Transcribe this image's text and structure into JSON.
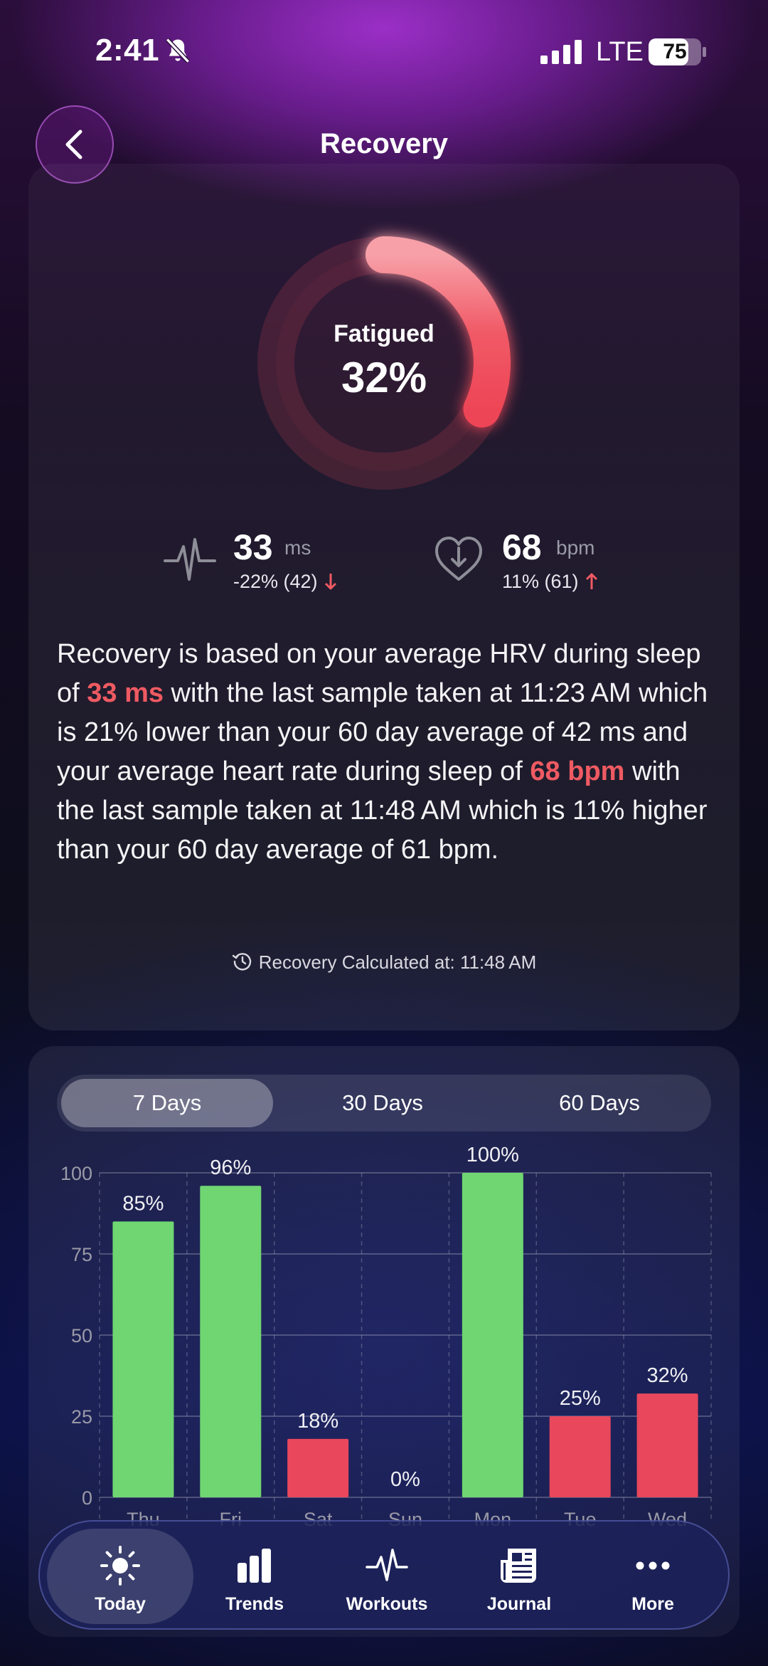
{
  "status_bar": {
    "time": "2:41",
    "network": "LTE",
    "battery": "75",
    "battery_level": 0.75
  },
  "header": {
    "title": "Recovery"
  },
  "recovery": {
    "state": "Fatigued",
    "percent_text": "32%",
    "percent": 32,
    "ring_color": "#f0505c"
  },
  "metrics": {
    "hrv": {
      "value": "33",
      "unit": "ms",
      "delta": "-22% (42)",
      "direction": "down"
    },
    "heart_rate": {
      "value": "68",
      "unit": "bpm",
      "delta": "11% (61)",
      "direction": "up"
    }
  },
  "description": {
    "p1": "Recovery is based on your average HRV during sleep of ",
    "hl1": "33 ms",
    "p2": " with the last sample taken at 11:23 AM which is 21% lower than your 60 day average of 42 ms and your average heart rate during sleep of ",
    "hl2": "68 bpm",
    "p3": " with the last sample taken at 11:48 AM which is 11% higher than your 60 day average of 61 bpm."
  },
  "calculated_at": "Recovery Calculated at: 11:48 AM",
  "range_tabs": [
    {
      "label": "7 Days",
      "active": true
    },
    {
      "label": "30 Days",
      "active": false
    },
    {
      "label": "60 Days",
      "active": false
    }
  ],
  "chart_data": {
    "type": "bar",
    "categories": [
      "Thu",
      "Fri",
      "Sat",
      "Sun",
      "Mon",
      "Tue",
      "Wed"
    ],
    "values": [
      85,
      96,
      18,
      0,
      100,
      25,
      32
    ],
    "data_labels": [
      "85%",
      "96%",
      "18%",
      "0%",
      "100%",
      "25%",
      "32%"
    ],
    "yticks": [
      0,
      25,
      50,
      75,
      100
    ],
    "ylim": [
      0,
      100
    ],
    "grid": true,
    "colors": {
      "good": "#6fd672",
      "bad": "#e8475c"
    }
  },
  "tabbar": [
    {
      "label": "Today",
      "icon": "sun-icon",
      "active": true
    },
    {
      "label": "Trends",
      "icon": "bar-chart-icon",
      "active": false
    },
    {
      "label": "Workouts",
      "icon": "pulse-icon",
      "active": false
    },
    {
      "label": "Journal",
      "icon": "newspaper-icon",
      "active": false
    },
    {
      "label": "More",
      "icon": "ellipsis-icon",
      "active": false
    }
  ]
}
